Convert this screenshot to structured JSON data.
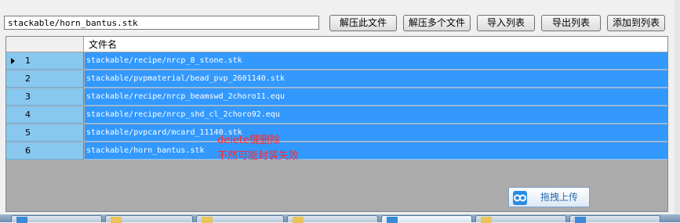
{
  "toolbar": {
    "path_value": "stackable/horn_bantus.stk",
    "buttons": [
      "解压此文件",
      "解压多个文件",
      "导入列表",
      "导出列表",
      "添加到列表"
    ]
  },
  "grid": {
    "column_header": "文件名",
    "rows": [
      {
        "num": "1",
        "file": "stackable/recipe/nrcp_8_stone.stk"
      },
      {
        "num": "2",
        "file": "stackable/pvpmaterial/bead_pvp_2601140.stk"
      },
      {
        "num": "3",
        "file": "stackable/recipe/nrcp_beamswd_2choro11.equ"
      },
      {
        "num": "4",
        "file": "stackable/recipe/nrcp_shd_cl_2choro92.equ"
      },
      {
        "num": "5",
        "file": "stackable/pvpcard/mcard_11140.stk"
      },
      {
        "num": "6",
        "file": "stackable/horn_bantus.stk"
      }
    ],
    "current_row": 0,
    "selection_color": "#3399ff",
    "row_header_color": "#88c7ee"
  },
  "annotation": {
    "line1": "delete键删除",
    "line2": "不然可能封装失败",
    "color": "#ff2a2a"
  },
  "upload": {
    "label": "拖拽上传",
    "icon": "cloud-link-icon"
  },
  "taskbar": {
    "items": [
      "blue-app-icon",
      "folder-icon",
      "folder-icon",
      "folder-icon",
      "folder-icon",
      "blue-app-icon"
    ]
  }
}
